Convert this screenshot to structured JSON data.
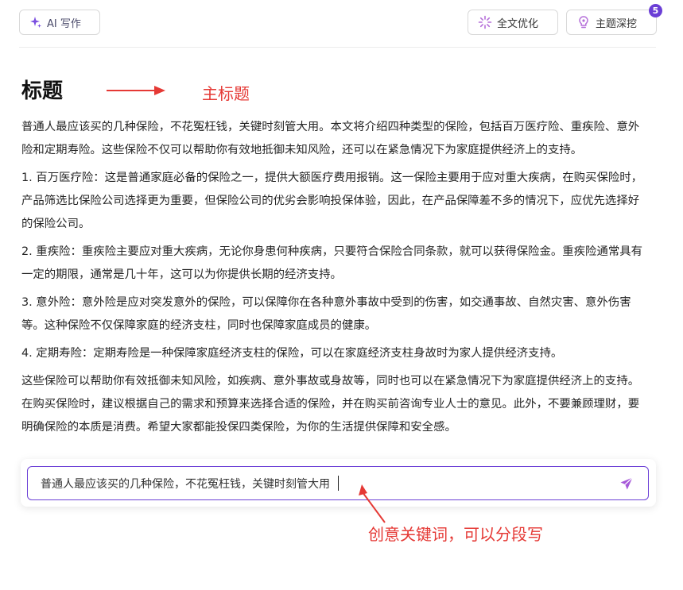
{
  "toolbar": {
    "ai_write_label": "AI 写作",
    "optimize_label": "全文优化",
    "deep_dig_label": "主题深挖",
    "deep_dig_badge": "5"
  },
  "document": {
    "title": "标题",
    "paragraphs": [
      "普通人最应该买的几种保险，不花冤枉钱，关键时刻管大用。本文将介绍四种类型的保险，包括百万医疗险、重疾险、意外险和定期寿险。这些保险不仅可以帮助你有效地抵御未知风险，还可以在紧急情况下为家庭提供经济上的支持。",
      "1. 百万医疗险：这是普通家庭必备的保险之一，提供大额医疗费用报销。这一保险主要用于应对重大疾病，在购买保险时，产品筛选比保险公司选择更为重要，但保险公司的优劣会影响投保体验，因此，在产品保障差不多的情况下，应优先选择好的保险公司。",
      "2. 重疾险：重疾险主要应对重大疾病，无论你身患何种疾病，只要符合保险合同条款，就可以获得保险金。重疾险通常具有一定的期限，通常是几十年，这可以为你提供长期的经济支持。",
      "3. 意外险：意外险是应对突发意外的保险，可以保障你在各种意外事故中受到的伤害，如交通事故、自然灾害、意外伤害等。这种保险不仅保障家庭的经济支柱，同时也保障家庭成员的健康。",
      "4. 定期寿险：定期寿险是一种保障家庭经济支柱的保险，可以在家庭经济支柱身故时为家人提供经济支持。",
      "这些保险可以帮助你有效抵御未知风险，如疾病、意外事故或身故等，同时也可以在紧急情况下为家庭提供经济上的支持。在购买保险时，建议根据自己的需求和预算来选择合适的保险，并在购买前咨询专业人士的意见。此外，不要兼顾理财，要明确保险的本质是消费。希望大家都能投保四类保险，为你的生活提供保障和安全感。"
    ]
  },
  "input": {
    "value": "普通人最应该买的几种保险，不花冤枉钱，关键时刻管大用"
  },
  "annotations": {
    "main_title": "主标题",
    "keyword_hint": "创意关键词，可以分段写"
  },
  "colors": {
    "accent": "#6b3fd6",
    "annotation": "#e53935"
  },
  "icons": {
    "ai_write": "sparkle-icon",
    "optimize": "spinner-icon",
    "deep_dig": "lightbulb-icon",
    "send": "send-icon"
  }
}
